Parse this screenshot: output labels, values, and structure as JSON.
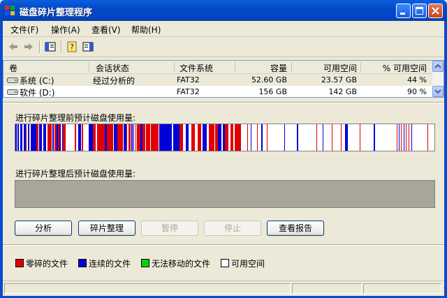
{
  "window": {
    "title": "磁盘碎片整理程序"
  },
  "menu": [
    {
      "label": "文件(F)"
    },
    {
      "label": "操作(A)"
    },
    {
      "label": "查看(V)"
    },
    {
      "label": "帮助(H)"
    }
  ],
  "toolbar": {
    "icons": [
      "back-arrow-icon",
      "forward-arrow-icon",
      "console-tree-icon",
      "help-icon",
      "properties-icon"
    ]
  },
  "volumes": {
    "columns": [
      "卷",
      "会话状态",
      "文件系统",
      "容量",
      "可用空间",
      "% 可用空间"
    ],
    "rows": [
      {
        "volume": "系统 (C:)",
        "status": "经过分析的",
        "fs": "FAT32",
        "capacity": "52.60 GB",
        "free": "23.57 GB",
        "pct": "44 %"
      },
      {
        "volume": "软件 (D:)",
        "status": "",
        "fs": "FAT32",
        "capacity": "156 GB",
        "free": "142 GB",
        "pct": "90 %"
      }
    ]
  },
  "before": {
    "label": "进行碎片整理前预计磁盘使用量:"
  },
  "after": {
    "label": "进行碎片整理后预计磁盘使用量:"
  },
  "buttons": {
    "analyze": "分析",
    "defrag": "碎片整理",
    "pause": "暂停",
    "stop": "停止",
    "report": "查看报告"
  },
  "legend": [
    {
      "label": "零碎的文件",
      "color": "#e00000"
    },
    {
      "label": "连续的文件",
      "color": "#0000d8"
    },
    {
      "label": "无法移动的文件",
      "color": "#00d800"
    },
    {
      "label": "可用空间",
      "color": "#ffffff"
    }
  ],
  "colors": {
    "fragmented": "#e00000",
    "contiguous": "#0000d8",
    "free": "#ffffff"
  }
}
